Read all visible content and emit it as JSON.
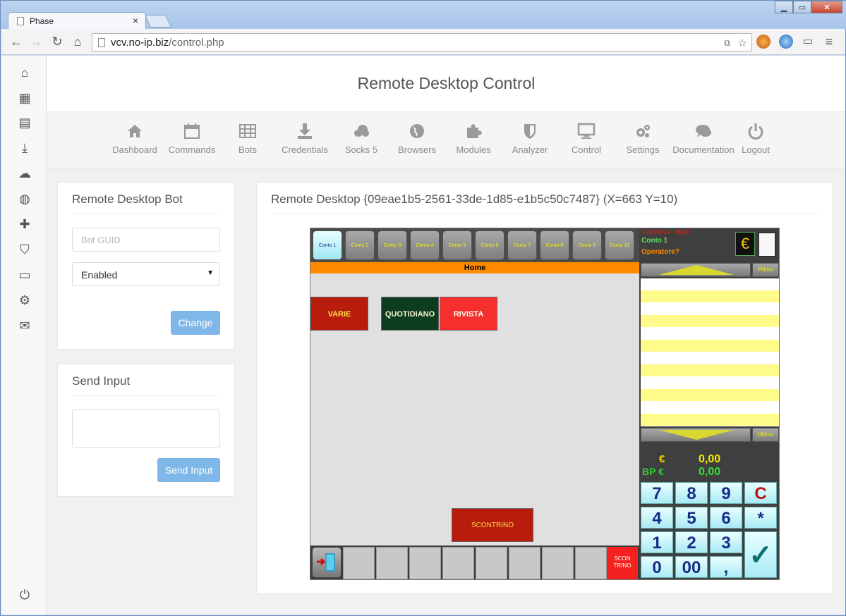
{
  "browser": {
    "tab_title": "Phase",
    "tab_close": "×",
    "url_host": "vcv.no-ip.biz",
    "url_path": "/control.php",
    "window_buttons": [
      "▁",
      "▭",
      "✕"
    ]
  },
  "header": {
    "title": "Remote Desktop Control"
  },
  "topnav": {
    "items": [
      {
        "label": "Dashboard",
        "icon": "home-icon"
      },
      {
        "label": "Commands",
        "icon": "calendar-icon"
      },
      {
        "label": "Bots",
        "icon": "grid-icon"
      },
      {
        "label": "Credentials",
        "icon": "download-icon"
      },
      {
        "label": "Socks 5",
        "icon": "cloud-icon"
      },
      {
        "label": "Browsers",
        "icon": "globe-icon"
      },
      {
        "label": "Modules",
        "icon": "puzzle-icon"
      },
      {
        "label": "Analyzer",
        "icon": "shield-icon"
      },
      {
        "label": "Control",
        "icon": "monitor-icon"
      },
      {
        "label": "Settings",
        "icon": "gears-icon"
      },
      {
        "label": "Documentation",
        "icon": "chat-icon"
      },
      {
        "label": "Logout",
        "icon": "power-icon"
      }
    ]
  },
  "bot_panel": {
    "title": "Remote Desktop Bot",
    "guid_placeholder": "Bot GUID",
    "status_value": "Enabled",
    "change_label": "Change"
  },
  "input_panel": {
    "title": "Send Input",
    "send_label": "Send Input"
  },
  "rd_panel": {
    "title": "Remote Desktop {09eae1b5-2561-33de-1d85-e1b5c50c7487} (X=663 Y=10)"
  },
  "screen": {
    "contos": [
      "Conto 1",
      "Conto 2",
      "Conto 3",
      "Conto 4",
      "Conto 5",
      "Conto 6",
      "Conto 7",
      "Conto 8",
      "Conto 9",
      "Conto 10"
    ],
    "home_label": "Home",
    "products": [
      {
        "label": "VARIE",
        "color": "#b71c0c"
      },
      {
        "label": "QUOTIDIANO",
        "color": "#0d3d1f"
      },
      {
        "label": "RIVISTA",
        "color": "#f52e2e"
      }
    ],
    "scontrino": "SCONTRINO",
    "scontrino_small": "SCON TRINO",
    "date_text": "15/02/2014 - 16:00",
    "conto_text": "Conto 1",
    "operatore_text": "Operatore?",
    "euro_sign": "€",
    "primo": "Primo",
    "ultimo": "Ultimo",
    "total_euro_label": "€",
    "total_euro_value": "0,00",
    "bp_label": "BP €",
    "bp_value": "0,00",
    "keys": [
      [
        "7",
        "8",
        "9",
        "C"
      ],
      [
        "4",
        "5",
        "6",
        "*"
      ],
      [
        "1",
        "2",
        "3",
        "✓"
      ],
      [
        "0",
        "00",
        ","
      ]
    ]
  },
  "colors": {
    "accent_button": "#7fb8e8",
    "home_bar": "#ff8a00"
  }
}
